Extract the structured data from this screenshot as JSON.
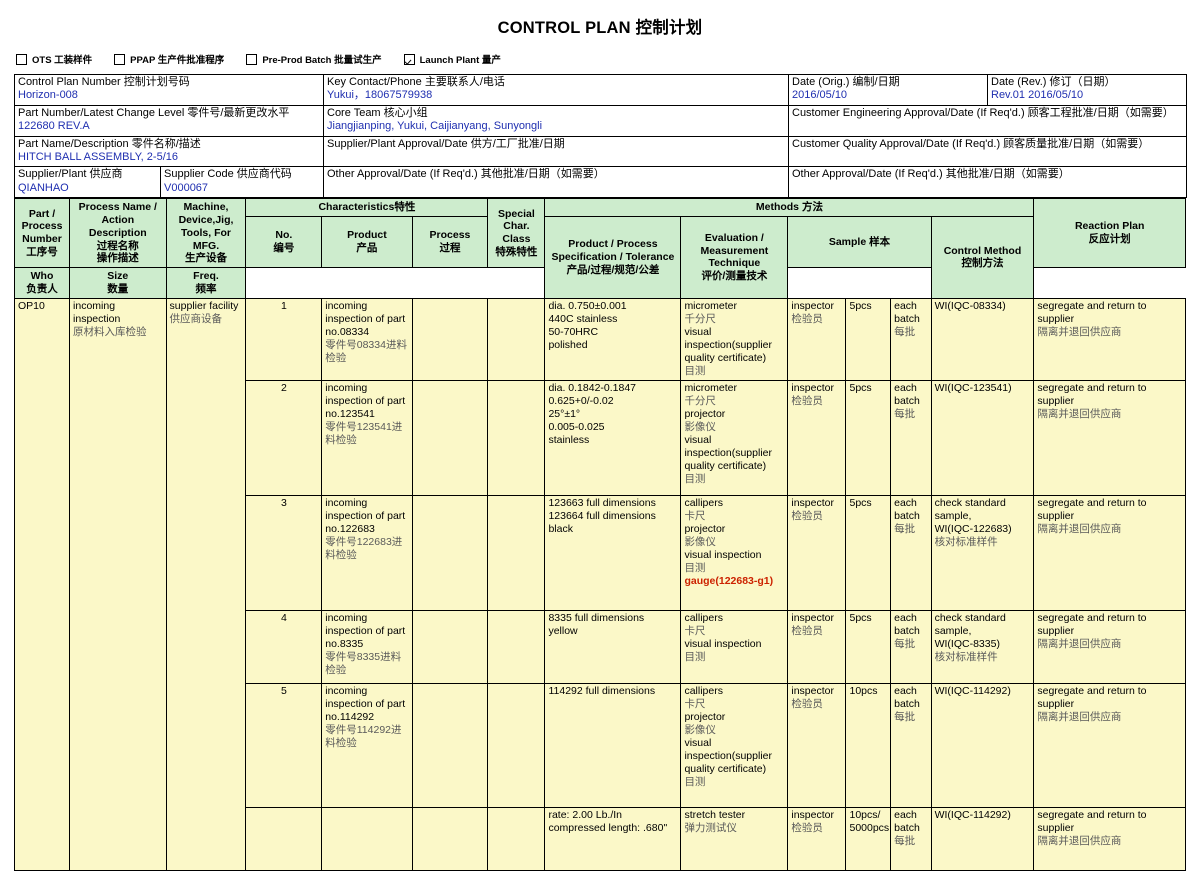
{
  "document": {
    "title": "CONTROL PLAN 控制计划"
  },
  "phase_checkboxes": [
    {
      "label": "OTS 工装样件",
      "checked": false,
      "name": "checkbox-ots"
    },
    {
      "label": "PPAP 生产件批准程序",
      "checked": false,
      "name": "checkbox-ppap"
    },
    {
      "label": "Pre-Prod Batch 批量试生产",
      "checked": false,
      "name": "checkbox-preprod"
    },
    {
      "label": "Launch Plant 量产",
      "checked": true,
      "name": "checkbox-launch"
    }
  ],
  "header": {
    "control_plan_number": {
      "label": "Control Plan Number 控制计划号码",
      "value": "Horizon-008"
    },
    "key_contact": {
      "label": "Key Contact/Phone 主要联系人/电话",
      "value": "Yukui，18067579938"
    },
    "date_orig": {
      "label": "Date (Orig.) 编制/日期",
      "value": "2016/05/10"
    },
    "date_rev": {
      "label": "Date (Rev.) 修订（日期）",
      "value": "Rev.01  2016/05/10"
    },
    "part_number": {
      "label": "Part Number/Latest Change Level 零件号/最新更改水平",
      "value": "122680 REV.A"
    },
    "core_team": {
      "label": "Core Team 核心小组",
      "value": "Jiangjianping, Yukui, Caijianyang, Sunyongli"
    },
    "customer_eng_approval": {
      "label": "Customer Engineering Approval/Date (If Req'd.) 顾客工程批准/日期（如需要）",
      "value": ""
    },
    "part_name": {
      "label": "Part Name/Description 零件名称/描述",
      "value": "HITCH BALL ASSEMBLY, 2-5/16"
    },
    "supplier_plant_approval": {
      "label": "Supplier/Plant Approval/Date 供方/工厂批准/日期",
      "value": ""
    },
    "customer_quality_approval": {
      "label": "Customer Quality Approval/Date (If Req'd.) 顾客质量批准/日期（如需要）",
      "value": ""
    },
    "supplier_plant": {
      "label": "Supplier/Plant 供应商",
      "value": "QIANHAO"
    },
    "supplier_code": {
      "label": "Supplier Code 供应商代码",
      "value": "V000067"
    },
    "other_approval_mid": {
      "label": "Other Approval/Date (If Req'd.) 其他批准/日期（如需要）",
      "value": ""
    },
    "other_approval_right": {
      "label": "Other Approval/Date (If Req'd.) 其他批准/日期（如需要）",
      "value": ""
    }
  },
  "table": {
    "group_headers": {
      "characteristics": "Characteristics特性",
      "methods": "Methods 方法",
      "sample": "Sample 样本"
    },
    "columns": {
      "part_process_number": "Part / Process Number\n工序号",
      "process_name": "Process Name / Action Description\n过程名称\n操作描述",
      "machine": "Machine, Device,Jig, Tools, For MFG.\n生产设备",
      "char_no": "No.\n编号",
      "char_product": "Product\n产品",
      "char_process": "Process\n过程",
      "special_char_class": "Special Char. Class\n特殊特性",
      "product_process_spec": "Product / Process Specification / Tolerance\n产品/过程/规范/公差",
      "evaluation": "Evaluation / Measurement Technique\n评价/测量技术",
      "sample_who": "Who\n负责人",
      "sample_size": "Size\n数量",
      "sample_freq": "Freq.\n频率",
      "control_method": "Control Method\n控制方法",
      "reaction_plan": "Reaction Plan\n反应计划"
    },
    "operation": {
      "part_process_number": "OP10",
      "process_name_en": "incoming inspection",
      "process_name_cn": "原材料入库检验",
      "machine_en": "supplier facility",
      "machine_cn": "供应商设备"
    },
    "rows": [
      {
        "no": "1",
        "product_en": "incoming inspection of part no.08334",
        "product_cn": "零件号08334进料检验",
        "process": "",
        "special_char": "",
        "spec": "dia. 0.750±0.001\n440C stainless\n50-70HRC\npolished",
        "evaluation_lines": [
          {
            "text": "micrometer",
            "style": "en"
          },
          {
            "text": "千分尺",
            "style": "cn"
          },
          {
            "text": "visual",
            "style": "en"
          },
          {
            "text": "inspection(supplier",
            "style": "en"
          },
          {
            "text": "quality certificate)",
            "style": "en"
          },
          {
            "text": "目测",
            "style": "cn"
          }
        ],
        "who_en": "inspector",
        "who_cn": "检验员",
        "size": "5pcs",
        "freq_en": "each batch",
        "freq_cn": "每批",
        "control_method": "WI(IQC-08334)",
        "reaction_en": "segregate and return to supplier",
        "reaction_cn": "隔离并退回供应商"
      },
      {
        "no": "2",
        "product_en": "incoming inspection of part no.123541",
        "product_cn": "零件号123541进料检验",
        "process": "",
        "special_char": "",
        "spec": "dia. 0.1842-0.1847\n0.625+0/-0.02\n25°±1°\n0.005-0.025\nstainless",
        "evaluation_lines": [
          {
            "text": "micrometer",
            "style": "en"
          },
          {
            "text": "千分尺",
            "style": "cn"
          },
          {
            "text": "projector",
            "style": "en"
          },
          {
            "text": "影像仪",
            "style": "cn"
          },
          {
            "text": "visual",
            "style": "en"
          },
          {
            "text": "inspection(supplier",
            "style": "en"
          },
          {
            "text": "quality certificate)",
            "style": "en"
          },
          {
            "text": "目测",
            "style": "cn"
          }
        ],
        "who_en": "inspector",
        "who_cn": "检验员",
        "size": "5pcs",
        "freq_en": "each batch",
        "freq_cn": "每批",
        "control_method": "WI(IQC-123541)",
        "reaction_en": "segregate and return to supplier",
        "reaction_cn": "隔离并退回供应商"
      },
      {
        "no": "3",
        "product_en": "incoming inspection of part no.122683",
        "product_cn": "零件号122683进料检验",
        "process": "",
        "special_char": "",
        "spec": "123663 full dimensions\n123664 full dimensions\nblack",
        "evaluation_lines": [
          {
            "text": "callipers",
            "style": "en"
          },
          {
            "text": "卡尺",
            "style": "cn"
          },
          {
            "text": "projector",
            "style": "en"
          },
          {
            "text": "影像仪",
            "style": "cn"
          },
          {
            "text": "visual inspection",
            "style": "en"
          },
          {
            "text": "目测",
            "style": "cn"
          },
          {
            "text": "gauge(122683-g1)",
            "style": "red"
          }
        ],
        "who_en": "inspector",
        "who_cn": "检验员",
        "size": "5pcs",
        "freq_en": "each batch",
        "freq_cn": "每批",
        "control_method": "check standard sample,\nWI(IQC-122683)\n核对标准样件",
        "reaction_en": "segregate and return to supplier",
        "reaction_cn": "隔离并退回供应商"
      },
      {
        "no": "4",
        "product_en": "incoming inspection of part no.8335",
        "product_cn": "零件号8335进料检验",
        "process": "",
        "special_char": "",
        "spec": "8335 full dimensions\nyellow",
        "evaluation_lines": [
          {
            "text": "callipers",
            "style": "en"
          },
          {
            "text": "卡尺",
            "style": "cn"
          },
          {
            "text": "visual inspection",
            "style": "en"
          },
          {
            "text": "目测",
            "style": "cn"
          }
        ],
        "who_en": "inspector",
        "who_cn": "检验员",
        "size": "5pcs",
        "freq_en": "each batch",
        "freq_cn": "每批",
        "control_method": "check standard sample,\nWI(IQC-8335)\n核对标准样件",
        "reaction_en": "segregate and return to supplier",
        "reaction_cn": "隔离并退回供应商"
      },
      {
        "no": "5",
        "product_en": "incoming inspection of part no.114292",
        "product_cn": "零件号114292进料检验",
        "process": "",
        "special_char": "",
        "spec": "114292 full dimensions",
        "evaluation_lines": [
          {
            "text": "callipers",
            "style": "en"
          },
          {
            "text": "卡尺",
            "style": "cn"
          },
          {
            "text": "projector",
            "style": "en"
          },
          {
            "text": "影像仪",
            "style": "cn"
          },
          {
            "text": "visual",
            "style": "en"
          },
          {
            "text": "inspection(supplier",
            "style": "en"
          },
          {
            "text": "quality certificate)",
            "style": "en"
          },
          {
            "text": "目测",
            "style": "cn"
          }
        ],
        "who_en": "inspector",
        "who_cn": "检验员",
        "size": "10pcs",
        "freq_en": "each batch",
        "freq_cn": "每批",
        "control_method": "WI(IQC-114292)",
        "reaction_en": "segregate and return to supplier",
        "reaction_cn": "隔离并退回供应商"
      },
      {
        "no": "",
        "product_en": "",
        "product_cn": "",
        "process": "",
        "special_char": "",
        "spec": "rate: 2.00 Lb./In\ncompressed length: .680\"",
        "evaluation_lines": [
          {
            "text": "stretch tester",
            "style": "en"
          },
          {
            "text": "弹力测试仪",
            "style": "cn"
          }
        ],
        "who_en": "inspector",
        "who_cn": "检验员",
        "size": "10pcs/\n5000pcs",
        "freq_en": "each batch",
        "freq_cn": "每批",
        "control_method": "WI(IQC-114292)",
        "reaction_en": "segregate and return to supplier",
        "reaction_cn": "隔离并退回供应商"
      }
    ]
  },
  "colors": {
    "header_fill": "#cdeccd",
    "body_fill": "#fbf8c8",
    "value_text": "#1f2fb0",
    "chinese_text": "#5a5a5a",
    "alert_text": "#cc2200"
  }
}
